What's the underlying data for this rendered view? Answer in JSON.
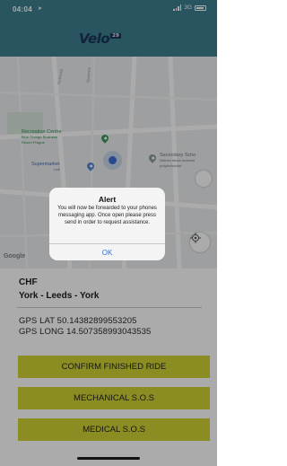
{
  "status_bar": {
    "time": "04:04",
    "network": "3G"
  },
  "header": {
    "logo_text": "Velo",
    "logo_badge": "29",
    "color": "#3d7f8e"
  },
  "map": {
    "pois": {
      "recreation": {
        "name": "Recreation Centre",
        "sub": "Blue Orange Business\nResort Prague"
      },
      "supermarket": {
        "name": "Supermarket",
        "sub": "Lidl"
      },
      "school": {
        "name": "Secondary Scho",
        "sub": "Střední škola technick\npolytechnická"
      }
    },
    "streets": [
      "Sportovní",
      "Technická"
    ],
    "attribution": "Google"
  },
  "ride": {
    "code": "CHF",
    "route": "York - Leeds - York"
  },
  "gps": {
    "lat": "GPS LAT 50.14382899553205",
    "long": "GPS LONG 14.507358993043535"
  },
  "buttons": {
    "confirm": "CONFIRM FINISHED RIDE",
    "mechanical": "MECHANICAL S.O.S",
    "medical": "MEDICAL S.O.S",
    "color": "#cfd235"
  },
  "alert": {
    "title": "Alert",
    "message": "You will now be forwarded to your phones messaging app. Once open please press send in order to request assistance.",
    "ok_label": "OK"
  }
}
